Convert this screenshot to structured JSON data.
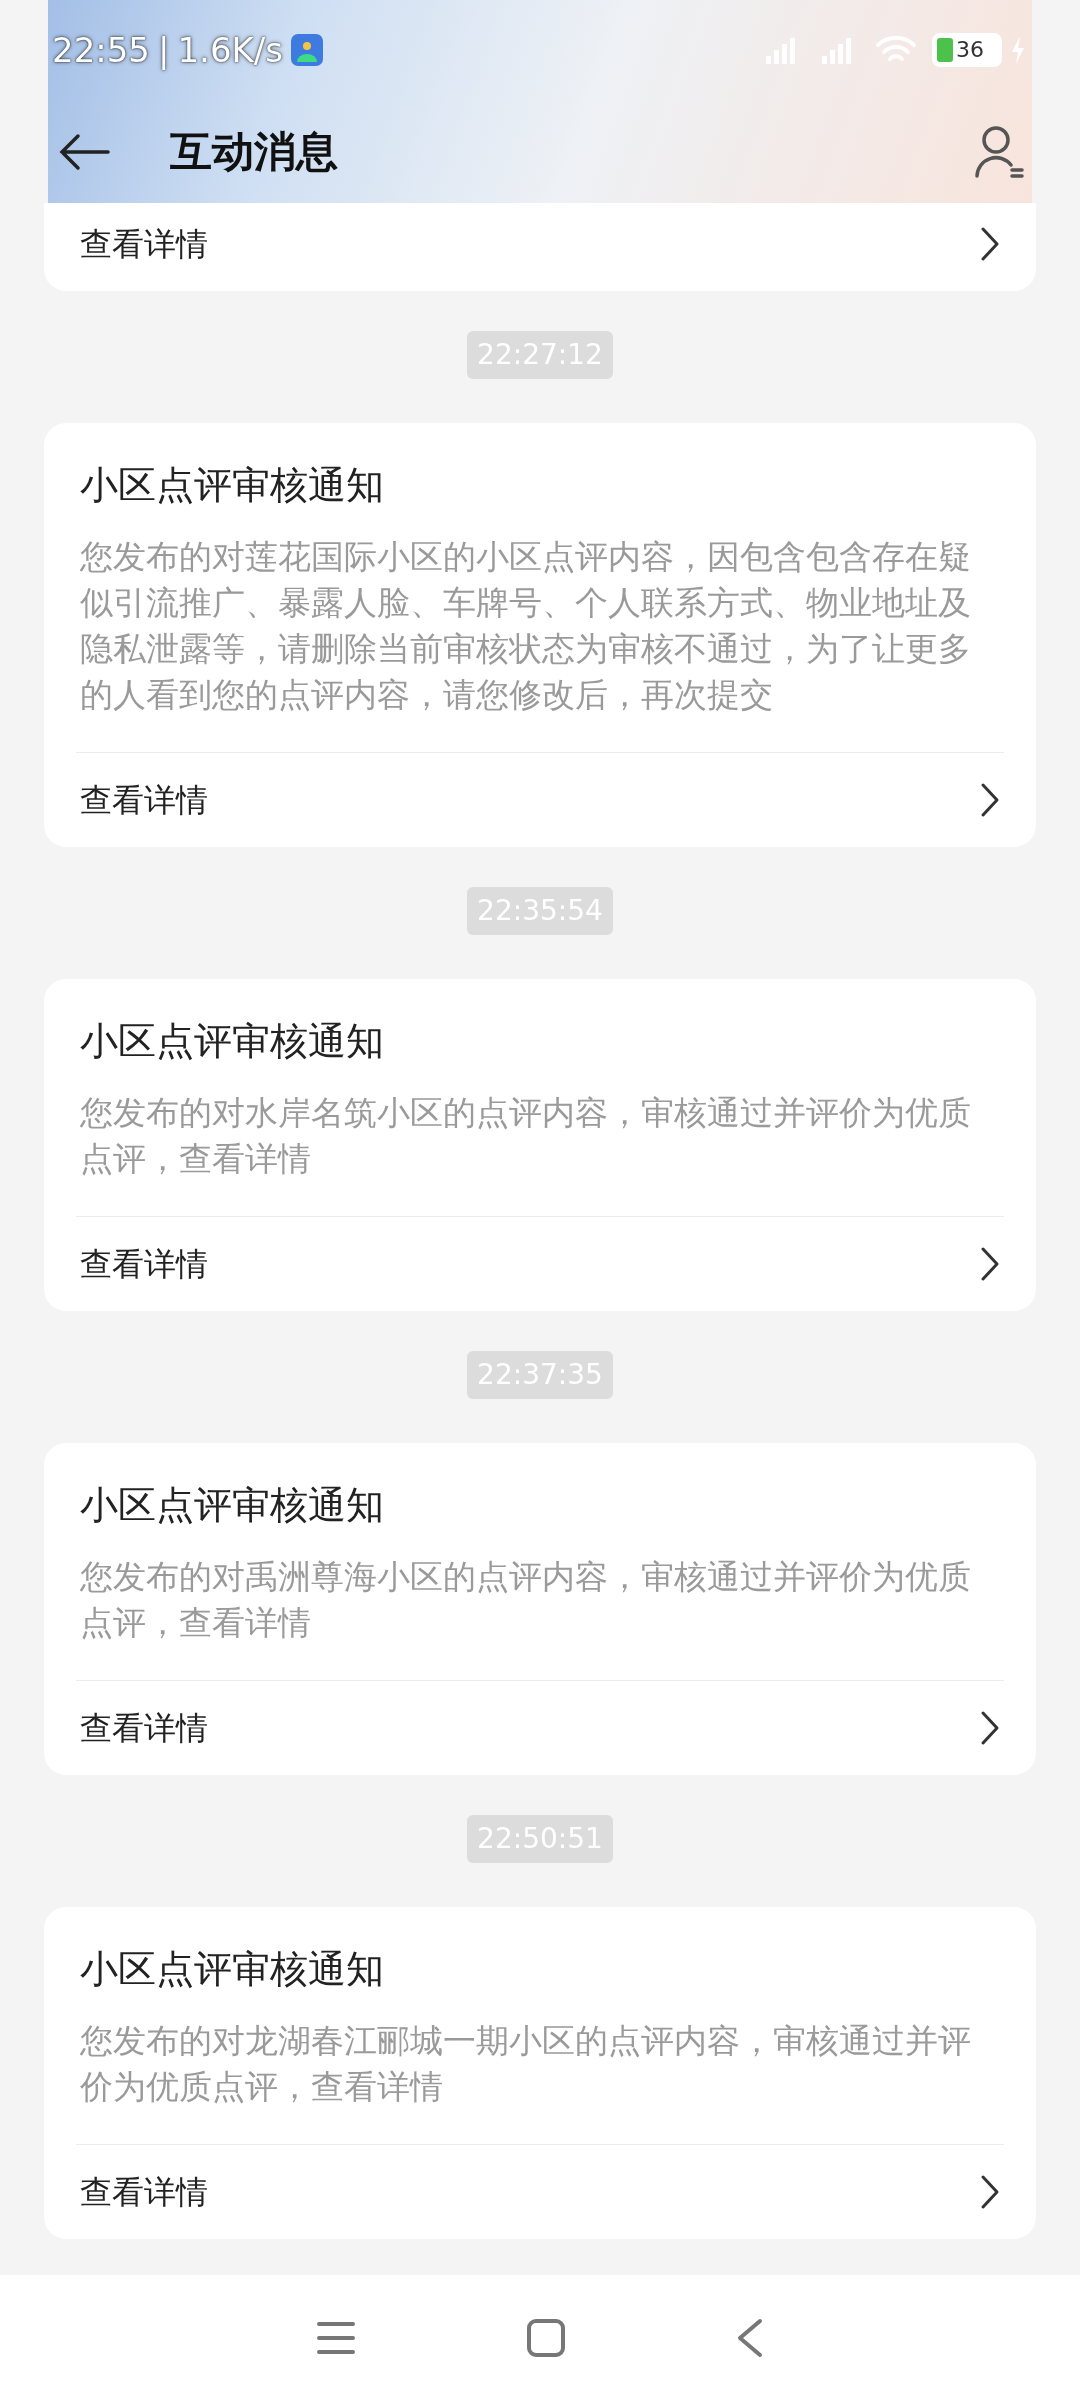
{
  "status_bar": {
    "time": "22:55",
    "separator": "|",
    "speed": "1.6K/s",
    "battery": "36"
  },
  "header": {
    "title": "互动消息"
  },
  "messages": [
    {
      "kind": "partial",
      "link": "查看详情"
    },
    {
      "kind": "full",
      "time": "22:27:12",
      "title": "小区点评审核通知",
      "body": "您发布的对莲花国际小区的小区点评内容，因包含包含存在疑似引流推广、暴露人脸、车牌号、个人联系方式、物业地址及隐私泄露等，请删除当前审核状态为审核不通过，为了让更多的人看到您的点评内容，请您修改后，再次提交",
      "link": "查看详情"
    },
    {
      "kind": "full",
      "time": "22:35:54",
      "title": "小区点评审核通知",
      "body": "您发布的对水岸名筑小区的点评内容，审核通过并评价为优质点评，查看详情",
      "link": "查看详情"
    },
    {
      "kind": "full",
      "time": "22:37:35",
      "title": "小区点评审核通知",
      "body": "您发布的对禹洲尊海小区的点评内容，审核通过并评价为优质点评，查看详情",
      "link": "查看详情"
    },
    {
      "kind": "full",
      "time": "22:50:51",
      "title": "小区点评审核通知",
      "body": "您发布的对龙湖春江郦城一期小区的点评内容，审核通过并评价为优质点评，查看详情",
      "link": "查看详情"
    }
  ]
}
